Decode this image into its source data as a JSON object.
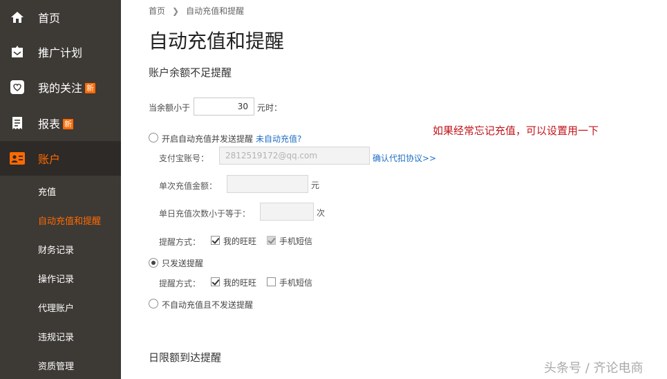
{
  "sidebar": {
    "items": [
      {
        "label": "首页",
        "icon": "home-icon"
      },
      {
        "label": "推广计划",
        "icon": "promotion-icon"
      },
      {
        "label": "我的关注",
        "icon": "heart-icon",
        "badge": "新"
      },
      {
        "label": "报表",
        "icon": "report-icon",
        "badge": "新"
      },
      {
        "label": "账户",
        "icon": "account-icon"
      }
    ],
    "sub_items": [
      {
        "label": "充值"
      },
      {
        "label": "自动充值和提醒"
      },
      {
        "label": "财务记录"
      },
      {
        "label": "操作记录"
      },
      {
        "label": "代理账户"
      },
      {
        "label": "违规记录"
      },
      {
        "label": "资质管理"
      }
    ],
    "accent_color": "#ff6a00"
  },
  "breadcrumb": {
    "home": "首页",
    "current": "自动充值和提醒"
  },
  "page_title": "自动充值和提醒",
  "balance_section": {
    "title": "账户余额不足提醒",
    "threshold_label": "当余额小于",
    "threshold_value": "30",
    "threshold_unit": "元时："
  },
  "option_auto": {
    "label": "开启自动充值并发送提醒",
    "help_link": "未自动充值?",
    "alipay_label": "支付宝账号：",
    "alipay_value": "2812519172@qq.com",
    "confirm_link": "确认代扣协议>>",
    "amount_label": "单次充值金额：",
    "amount_unit": "元",
    "times_label": "单日充值次数小于等于：",
    "times_unit": "次",
    "remind_label": "提醒方式：",
    "wangwang": "我的旺旺",
    "sms": "手机短信"
  },
  "option_remind_only": {
    "label": "只发送提醒",
    "remind_label": "提醒方式：",
    "wangwang": "我的旺旺",
    "sms": "手机短信"
  },
  "option_none": {
    "label": "不自动充值且不发送提醒"
  },
  "daily_section": {
    "title": "日限额到达提醒"
  },
  "annotation": "如果经常忘记充值，可以设置用一下",
  "watermark": "头条号 / 齐论电商"
}
